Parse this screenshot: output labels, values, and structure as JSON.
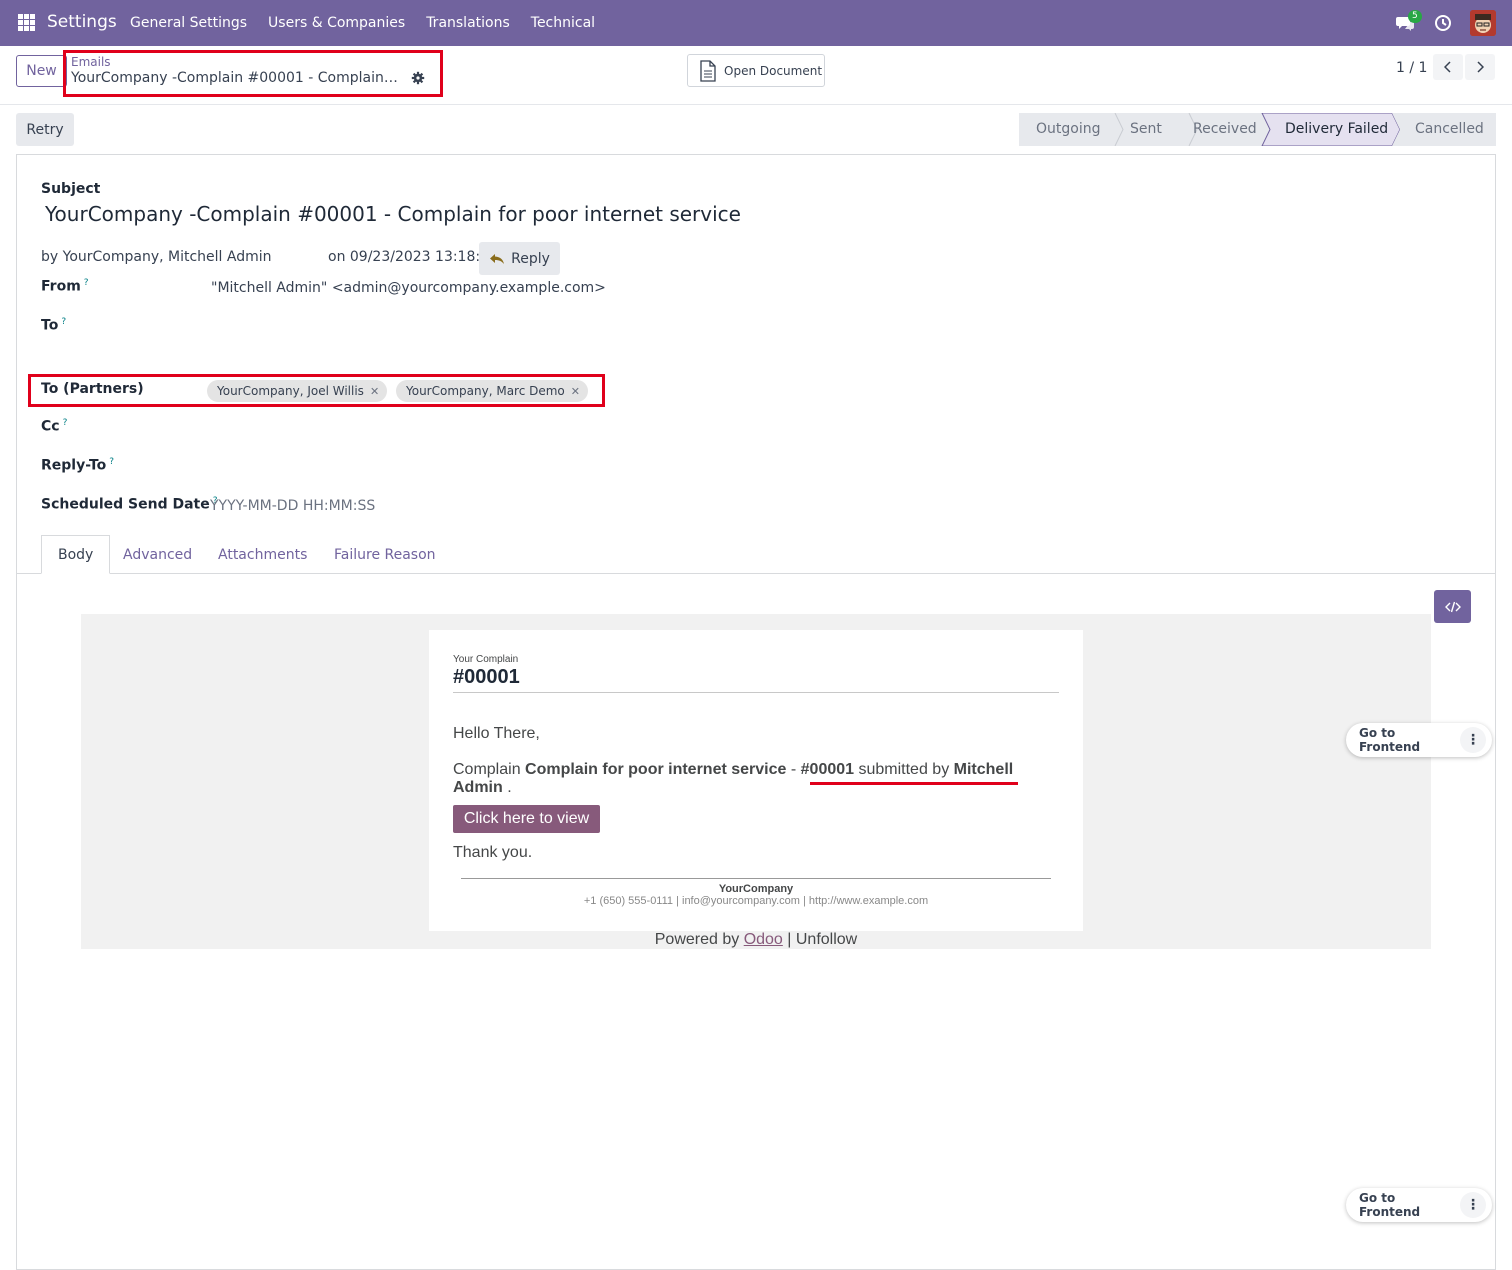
{
  "navbar": {
    "brand": "Settings",
    "menu": [
      "General Settings",
      "Users & Companies",
      "Translations",
      "Technical"
    ],
    "chat_count": "5"
  },
  "control": {
    "new_label": "New",
    "breadcrumb_parent": "Emails",
    "breadcrumb_current": "YourCompany -Complain #00001 - Complain for poor internet service",
    "open_document_label": "Open Document",
    "pager": "1 / 1"
  },
  "actions": {
    "retry_label": "Retry"
  },
  "statusbar": {
    "stages": [
      "Outgoing",
      "Sent",
      "Received",
      "Delivery Failed",
      "Cancelled"
    ],
    "active": "Delivery Failed"
  },
  "form": {
    "subject_label": "Subject",
    "subject_value": "YourCompany -Complain  #00001 - Complain for poor internet service",
    "by_text": "by  YourCompany, Mitchell Admin",
    "on_text": "on 09/23/2023 13:18:45",
    "reply_label": "Reply",
    "from_label": "From",
    "from_value": "\"Mitchell Admin\" <admin@yourcompany.example.com>",
    "to_label": "To",
    "to_partners_label": "To (Partners)",
    "partners": [
      "YourCompany, Joel Willis",
      "YourCompany, Marc Demo"
    ],
    "cc_label": "Cc",
    "reply_to_label": "Reply-To",
    "scheduled_label": "Scheduled Send Date",
    "scheduled_placeholder": "YYYY-MM-DD HH:MM:SS",
    "help_mark": "?"
  },
  "tabs": [
    "Body",
    "Advanced",
    "Attachments",
    "Failure Reason"
  ],
  "mail": {
    "small_title": "Your Complain",
    "reference": "#00001",
    "greeting": "Hello There,",
    "line_prefix": "Complain ",
    "complain_name": "Complain for poor internet service",
    "dash": " - ",
    "submitted_by": " submitted by ",
    "user": "Mitchell Admin",
    "line_suffix": " .",
    "button_label": "Click here to view",
    "thanks": "Thank you.",
    "company": "YourCompany",
    "contact": "+1 (650) 555-0111 | info@yourcompany.com | http://www.example.com",
    "powered_prefix": "Powered by ",
    "powered_link": "Odoo",
    "powered_suffix": " | Unfollow"
  },
  "frontend": {
    "label": "Go to Frontend"
  },
  "colors": {
    "navbar": "#71639e",
    "highlight_box": "#e0001b",
    "mail_button": "#875a7b"
  }
}
